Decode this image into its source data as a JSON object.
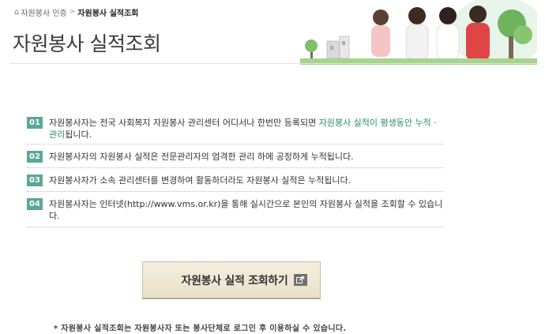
{
  "breadcrumb": {
    "home_icon": "home-icon",
    "home_label": "자원봉사 인증",
    "separator": ">",
    "current": "자원봉사 실적조회"
  },
  "page_title": "자원봉사 실적조회",
  "info_items": [
    {
      "number": "01",
      "text_before": "자원봉사자는 전국 사회복지 자원봉사 관리센터 어디서나 한번만 등록되면 ",
      "highlight": "자원봉사 실적이 평생동안 누적 · 관리",
      "text_after": "됩니다."
    },
    {
      "number": "02",
      "text": "자원봉사자의 자원봉사 실적은 전문관리자의 엄격한 관리 하에 공정하게 누적됩니다."
    },
    {
      "number": "03",
      "text": "자원봉사자가 소속 관리센터를 변경하여 활동하더라도 자원봉사 실적은 누적됩니다."
    },
    {
      "number": "04",
      "text": "자원봉사자는 인터넷(http://www.vms.or.kr)을 통해 실시간으로 본인의 자원봉사 실적을 조회할 수 있습니다."
    }
  ],
  "query_button": {
    "label": "자원봉사 실적 조회하기",
    "icon": "external-arrow-icon"
  },
  "footer_note": "* 자원봉사 실적조회는 자원봉사자 또는 봉사단체로 로그인 후 이용하실 수 있습니다.",
  "colors": {
    "number_badge": "#5aa79a",
    "highlight_text": "#2d8a6c",
    "button_bg": "#efe7d4"
  }
}
